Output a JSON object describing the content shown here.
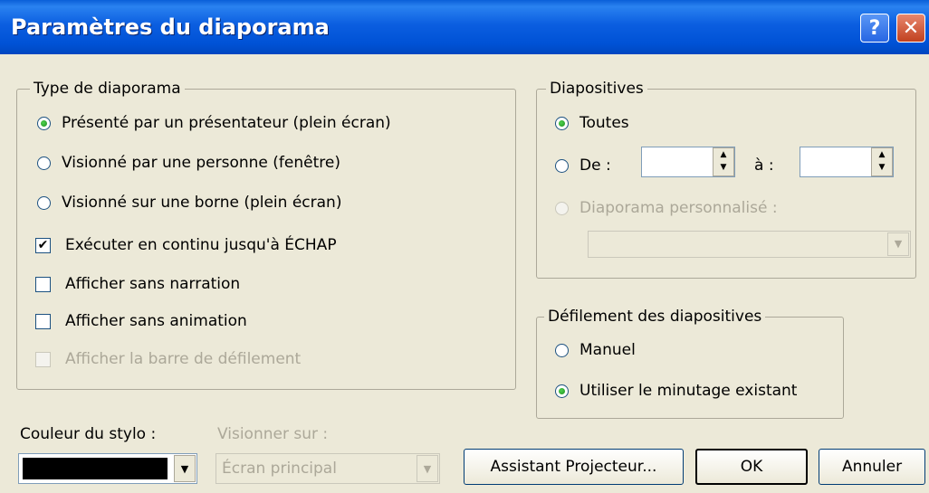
{
  "window": {
    "title": "Paramètres du diaporama",
    "help_label": "?",
    "close_label": "✕"
  },
  "type_group": {
    "legend": "Type de diaporama",
    "radios": [
      {
        "label": "Présenté par un présentateur (plein écran)",
        "checked": true
      },
      {
        "label": "Visionné par une personne (fenêtre)",
        "checked": false
      },
      {
        "label": "Visionné sur une borne (plein écran)",
        "checked": false
      }
    ],
    "checkboxes": [
      {
        "label": "Exécuter en continu jusqu'à ÉCHAP",
        "checked": true,
        "disabled": false
      },
      {
        "label": "Afficher sans narration",
        "checked": false,
        "disabled": false
      },
      {
        "label": "Afficher sans animation",
        "checked": false,
        "disabled": false
      },
      {
        "label": "Afficher la barre de défilement",
        "checked": false,
        "disabled": true
      }
    ]
  },
  "slides_group": {
    "legend": "Diapositives",
    "all_label": "Toutes",
    "from_label": "De :",
    "from_value": "",
    "to_label": "à :",
    "to_value": "",
    "custom_label": "Diaporama personnalisé :",
    "custom_value": ""
  },
  "advance_group": {
    "legend": "Défilement des diapositives",
    "manual_label": "Manuel",
    "timing_label": "Utiliser le minutage existant",
    "selected": "timing"
  },
  "pen": {
    "label": "Couleur du stylo :",
    "color": "#000000"
  },
  "show_on": {
    "label": "Visionner sur :",
    "value": "Écran principal"
  },
  "buttons": {
    "projector_wizard": "Assistant Projecteur...",
    "ok": "OK",
    "cancel": "Annuler"
  },
  "colors": {
    "title_bar": "#0055e5",
    "dialog_bg": "#ece9d8",
    "radio_dot": "#21a121"
  }
}
